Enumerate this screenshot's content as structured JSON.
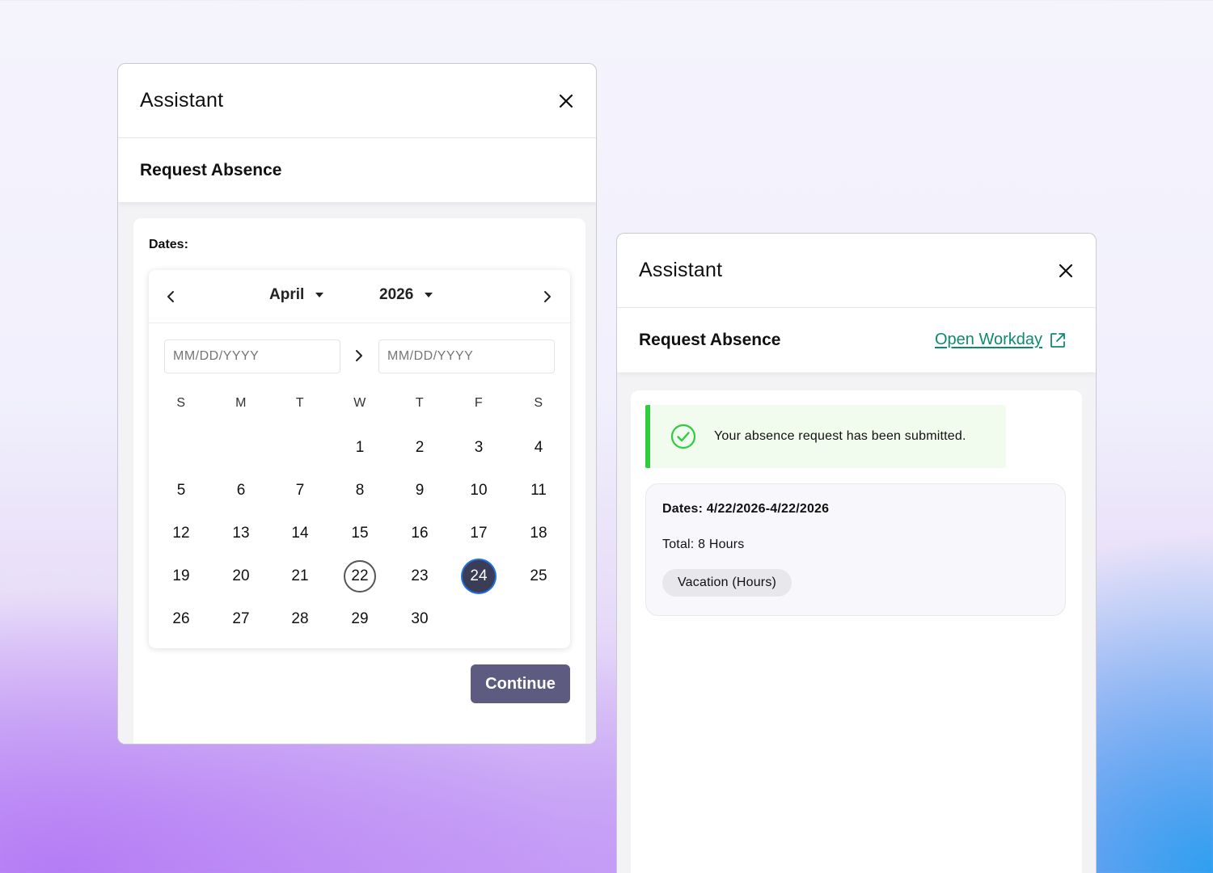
{
  "left_panel": {
    "title": "Assistant",
    "section_title": "Request Absence",
    "dates_label": "Dates:",
    "calendar": {
      "month": "April",
      "year": "2026",
      "start_placeholder": "MM/DD/YYYY",
      "end_placeholder": "MM/DD/YYYY",
      "weekdays": [
        "S",
        "M",
        "T",
        "W",
        "T",
        "F",
        "S"
      ],
      "first_weekday_index": 3,
      "days_in_month": 30,
      "today": 22,
      "selected": 24
    },
    "continue_label": "Continue"
  },
  "right_panel": {
    "title": "Assistant",
    "section_title": "Request Absence",
    "open_workday_label": "Open Workday",
    "success_message": "Your absence request has been submitted.",
    "summary": {
      "dates": "Dates: 4/22/2026-4/22/2026",
      "total": "Total: 8 Hours",
      "type_tag": "Vacation (Hours)"
    }
  },
  "colors": {
    "accent_link": "#0d8a6e",
    "success": "#2ecc40",
    "primary_button": "#5d5b7f",
    "selected_day": "#3a3d55"
  },
  "icons": {
    "close": "close-icon",
    "prev": "chevron-left-icon",
    "next": "chevron-right-icon",
    "range": "chevron-right-icon",
    "external": "external-link-icon",
    "success": "check-circle-icon"
  }
}
